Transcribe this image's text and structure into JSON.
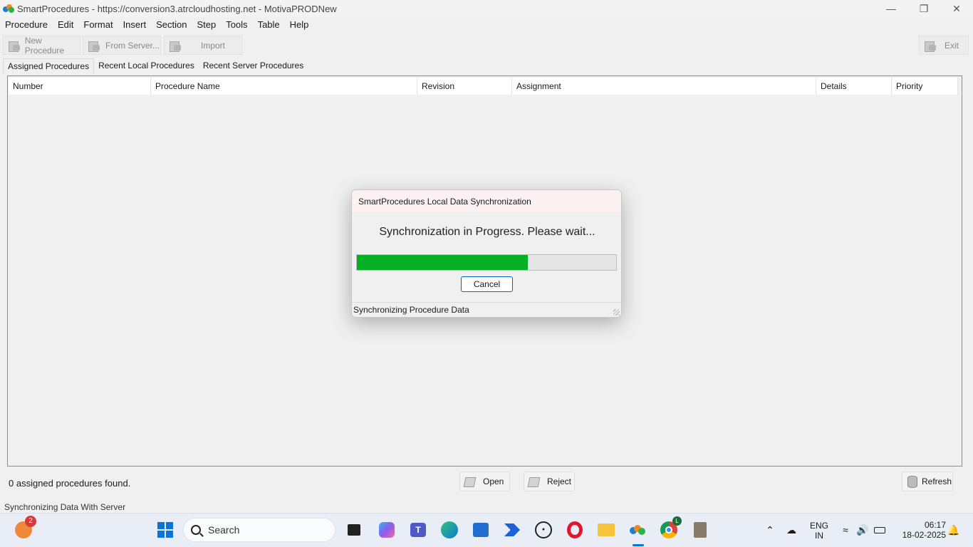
{
  "window": {
    "title": "SmartProcedures - https://conversion3.atrcloudhosting.net - MotivaPRODNew",
    "controls": [
      "minimize-icon",
      "restore-icon",
      "close-icon"
    ]
  },
  "menu": [
    "Procedure",
    "Edit",
    "Format",
    "Insert",
    "Section",
    "Step",
    "Tools",
    "Table",
    "Help"
  ],
  "toolbar": {
    "new_procedure": "New Procedure",
    "from_server": "From Server...",
    "import": "Import",
    "exit": "Exit"
  },
  "tabs": [
    "Assigned Procedures",
    "Recent Local Procedures",
    "Recent Server Procedures"
  ],
  "table": {
    "columns": [
      "Number",
      "Procedure Name",
      "Revision",
      "Assignment",
      "Details",
      "Priority"
    ],
    "rows": []
  },
  "dialog": {
    "title": "SmartProcedures Local Data Synchronization",
    "message": "Synchronization in Progress.  Please wait...",
    "progress_percent": 66,
    "progress_color": "#06b025",
    "cancel_label": "Cancel",
    "status": "Synchronizing Procedure Data"
  },
  "footer": {
    "found_text": "0 assigned procedures found.",
    "open_label": "Open",
    "reject_label": "Reject",
    "refresh_label": "Refresh"
  },
  "status_bar": "Synchronizing Data With Server",
  "taskbar": {
    "weather_badge": "2",
    "search_label": "Search",
    "chrome_badge": "L",
    "language": "ENG",
    "region": "IN",
    "time": "06:17",
    "date": "18-02-2025"
  }
}
